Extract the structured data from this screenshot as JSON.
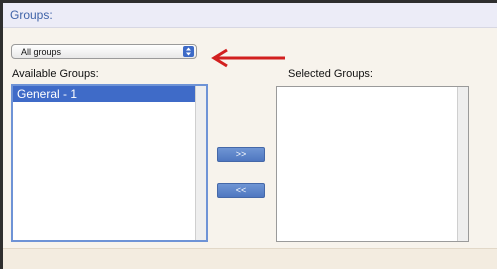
{
  "panel": {
    "title": "Groups:"
  },
  "filter": {
    "selected_value": "All groups"
  },
  "available": {
    "label": "Available Groups:",
    "items": [
      {
        "label": "General  - 1",
        "selected": true
      }
    ]
  },
  "selected_groups": {
    "label": "Selected Groups:",
    "items": []
  },
  "actions": {
    "add_label": ">>",
    "remove_label": "<<"
  },
  "colors": {
    "accent": "#3f6bc8",
    "annotation_arrow": "#d21f1f"
  }
}
